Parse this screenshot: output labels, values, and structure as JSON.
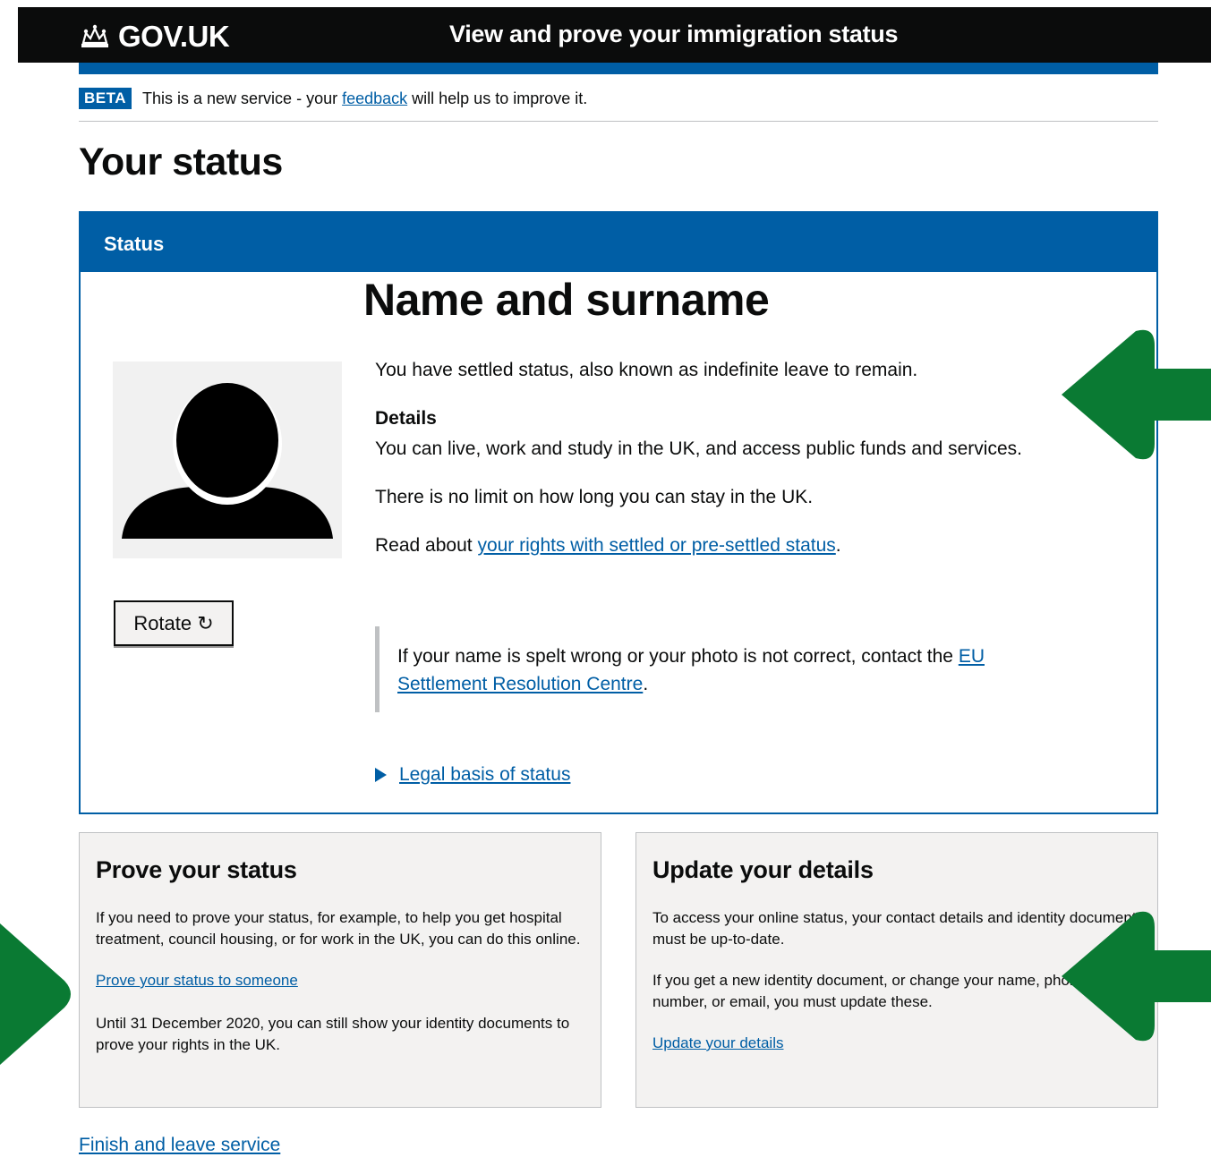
{
  "header": {
    "logo_text": "GOV.UK",
    "service_name": "View and prove your immigration status"
  },
  "phase_banner": {
    "tag": "BETA",
    "text_before": "This is a new service - your ",
    "link": "feedback",
    "text_after": " will help us to improve it."
  },
  "page_title": "Your status",
  "status_panel": {
    "heading": "Status",
    "name": "Name and surname",
    "rotate_button": "Rotate ↻",
    "summary": "You have settled status, also known as indefinite leave to remain.",
    "details_heading": "Details",
    "details_text": "You can live, work and study in the UK, and access public funds and services.",
    "limit_text": "There is no limit on how long you can stay in the UK.",
    "read_about_prefix": "Read about ",
    "rights_link": "your rights with settled or pre-settled status",
    "read_about_suffix": ".",
    "inset_text": "If your name is spelt wrong or your photo is not correct, contact the ",
    "inset_link": "EU Settlement Resolution Centre",
    "inset_suffix": ".",
    "legal_basis_link": "Legal basis of status"
  },
  "prove_card": {
    "heading": "Prove your status",
    "text": "If you need to prove your status, for example, to help you get hospital treatment, council housing, or for work in the UK, you can do this online.",
    "link": "Prove your status to someone",
    "note": "Until 31 December 2020, you can still show your identity documents to prove your rights in the UK."
  },
  "update_card": {
    "heading": "Update your details",
    "text": "To access your online status, your contact details and identity document must be up-to-date.",
    "text2": "If you get a new identity document, or change your name, phone number, or email, you must update these.",
    "link": "Update your details"
  },
  "footer_link": "Finish and leave service",
  "colors": {
    "govuk_black": "#0b0c0c",
    "govuk_blue": "#005ea5",
    "annotation_arrow": "#0a7a33"
  }
}
